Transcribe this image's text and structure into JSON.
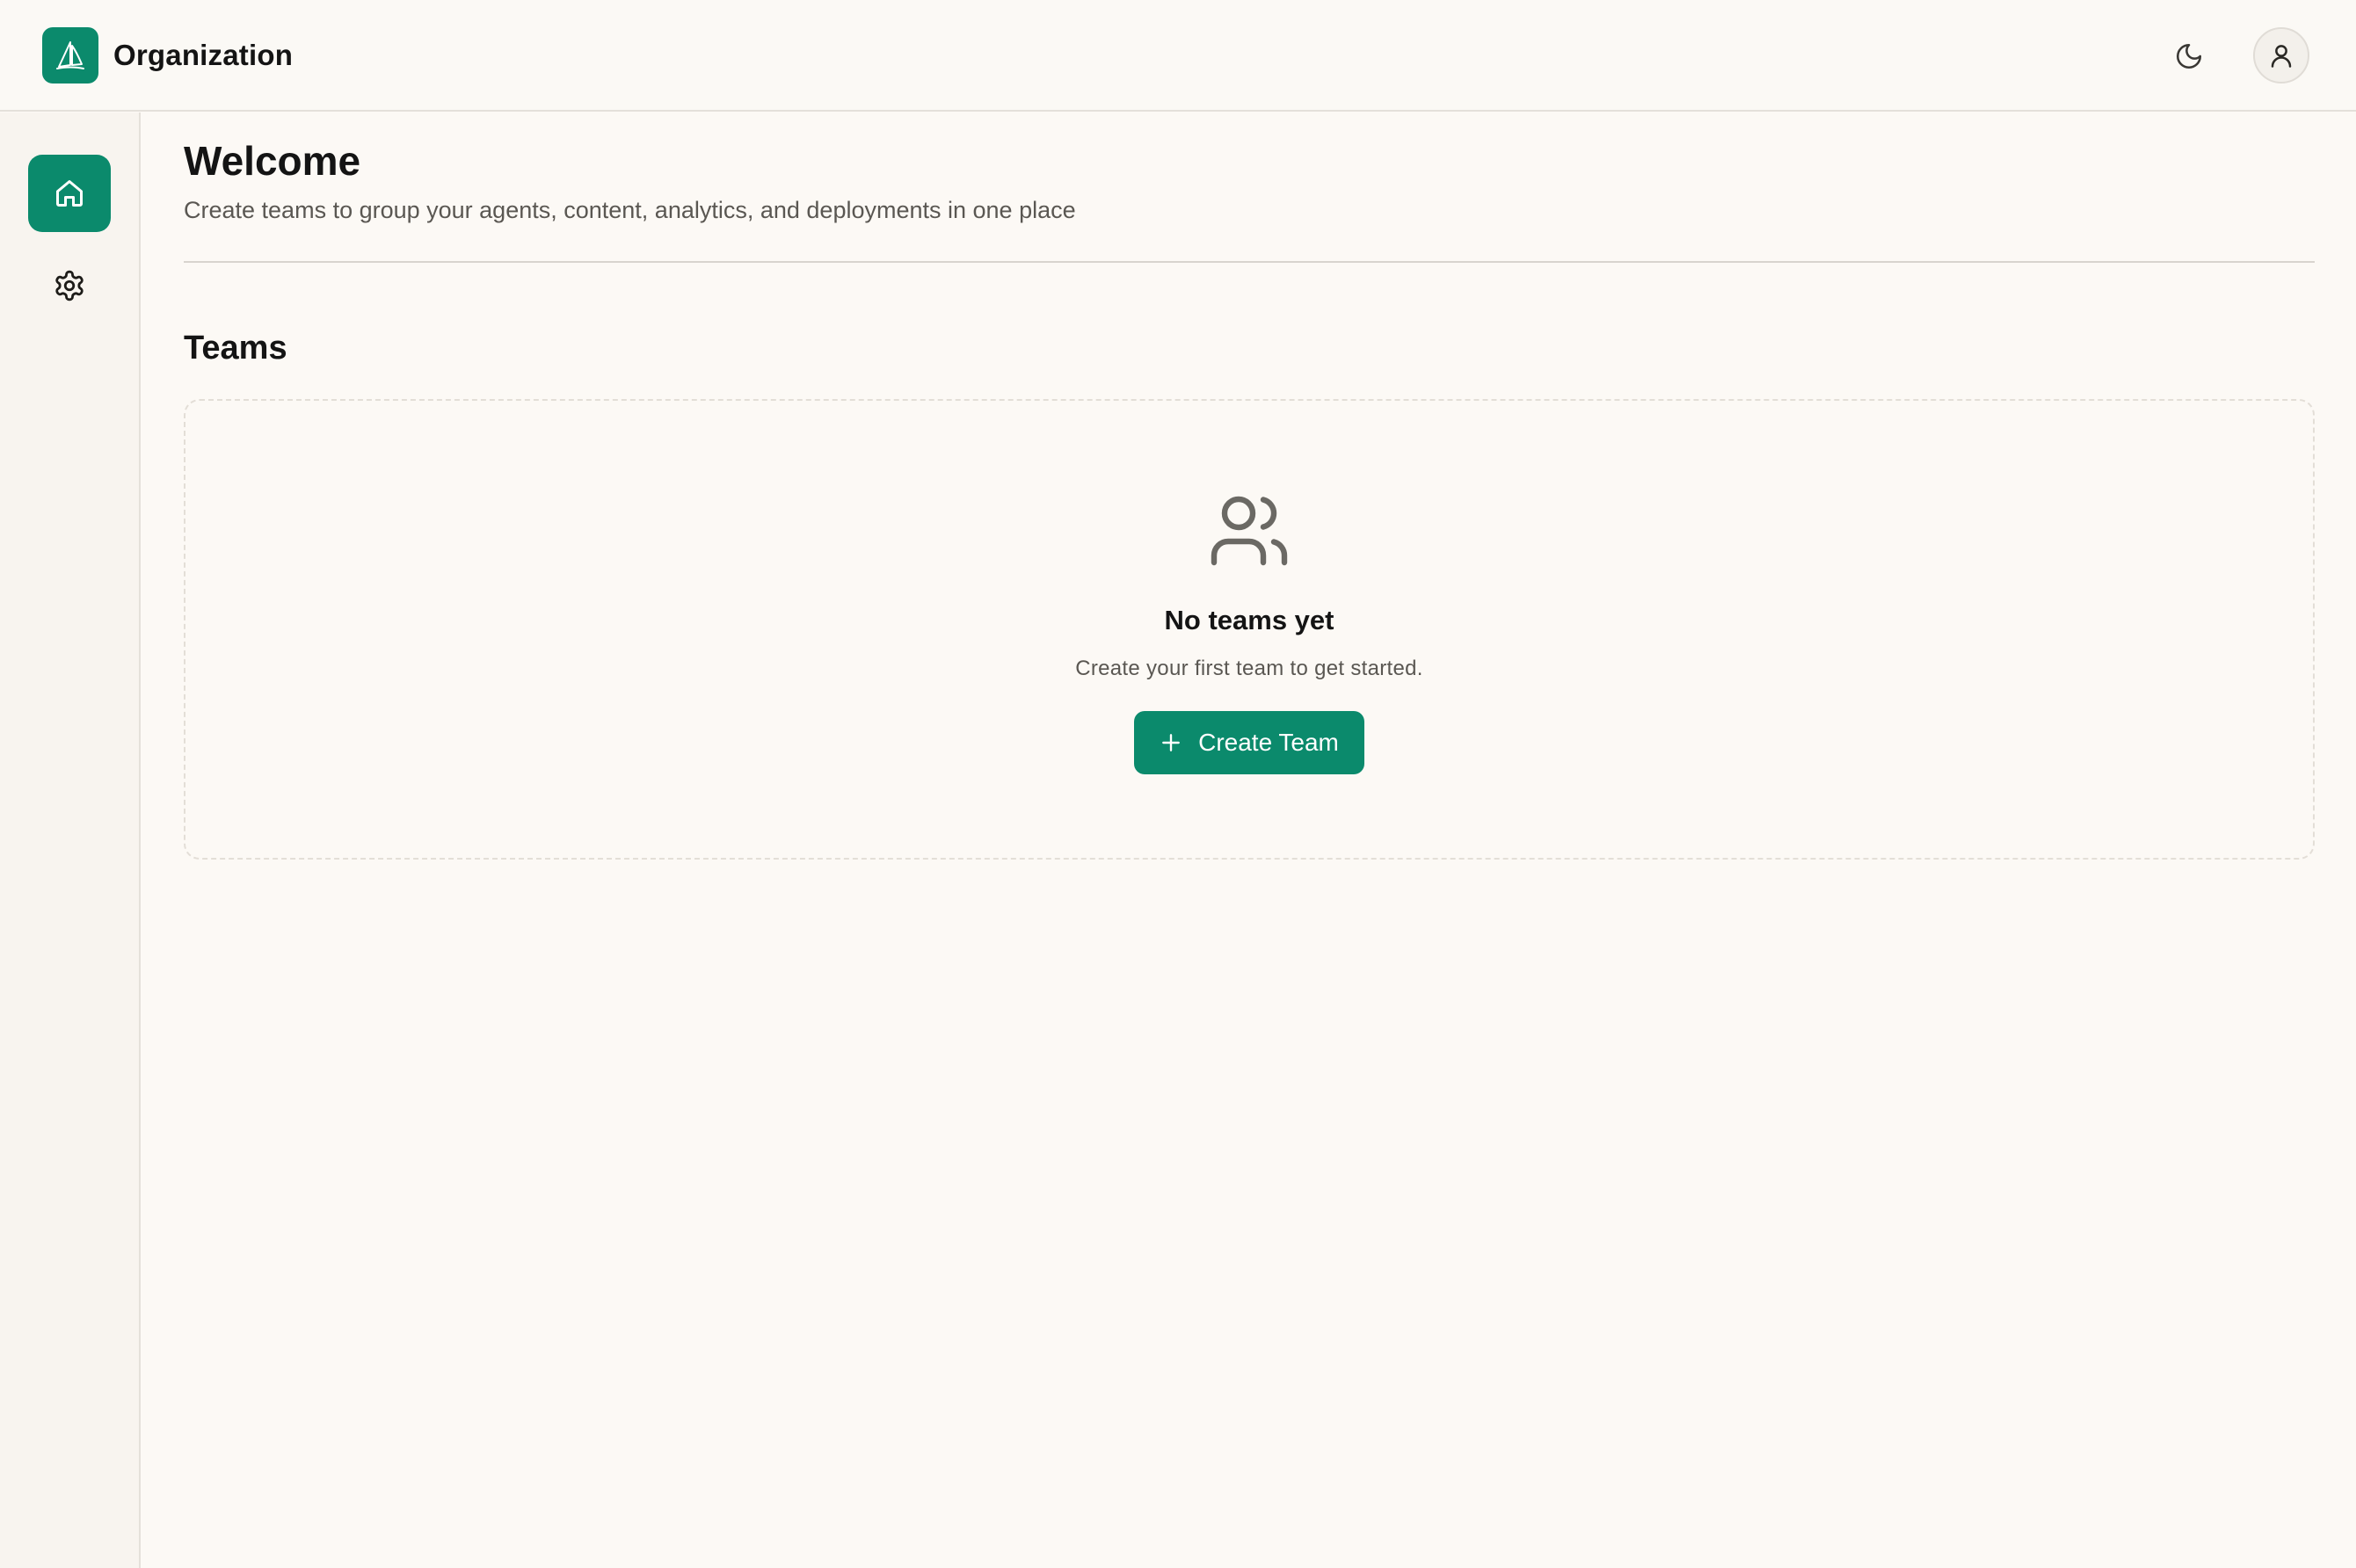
{
  "header": {
    "org_name": "Organization",
    "logo_icon": "sailboat-logo",
    "theme_toggle_icon": "moon-icon",
    "user_icon": "user-icon"
  },
  "sidebar": {
    "items": [
      {
        "icon": "home-icon",
        "active": true
      },
      {
        "icon": "gear-icon",
        "active": false
      }
    ]
  },
  "main": {
    "title": "Welcome",
    "subtitle": "Create teams to group your agents, content, analytics, and deployments in one place",
    "teams_section": {
      "title": "Teams",
      "empty_icon": "users-icon",
      "empty_title": "No teams yet",
      "empty_description": "Create your first team to get started.",
      "create_button_label": "Create Team",
      "create_button_icon": "plus-icon"
    }
  },
  "colors": {
    "accent": "#0b8a6c",
    "background": "#fcf9f5",
    "sidebar_bg": "#f8f4ef",
    "text_primary": "#141414",
    "text_secondary": "#5a5752"
  }
}
